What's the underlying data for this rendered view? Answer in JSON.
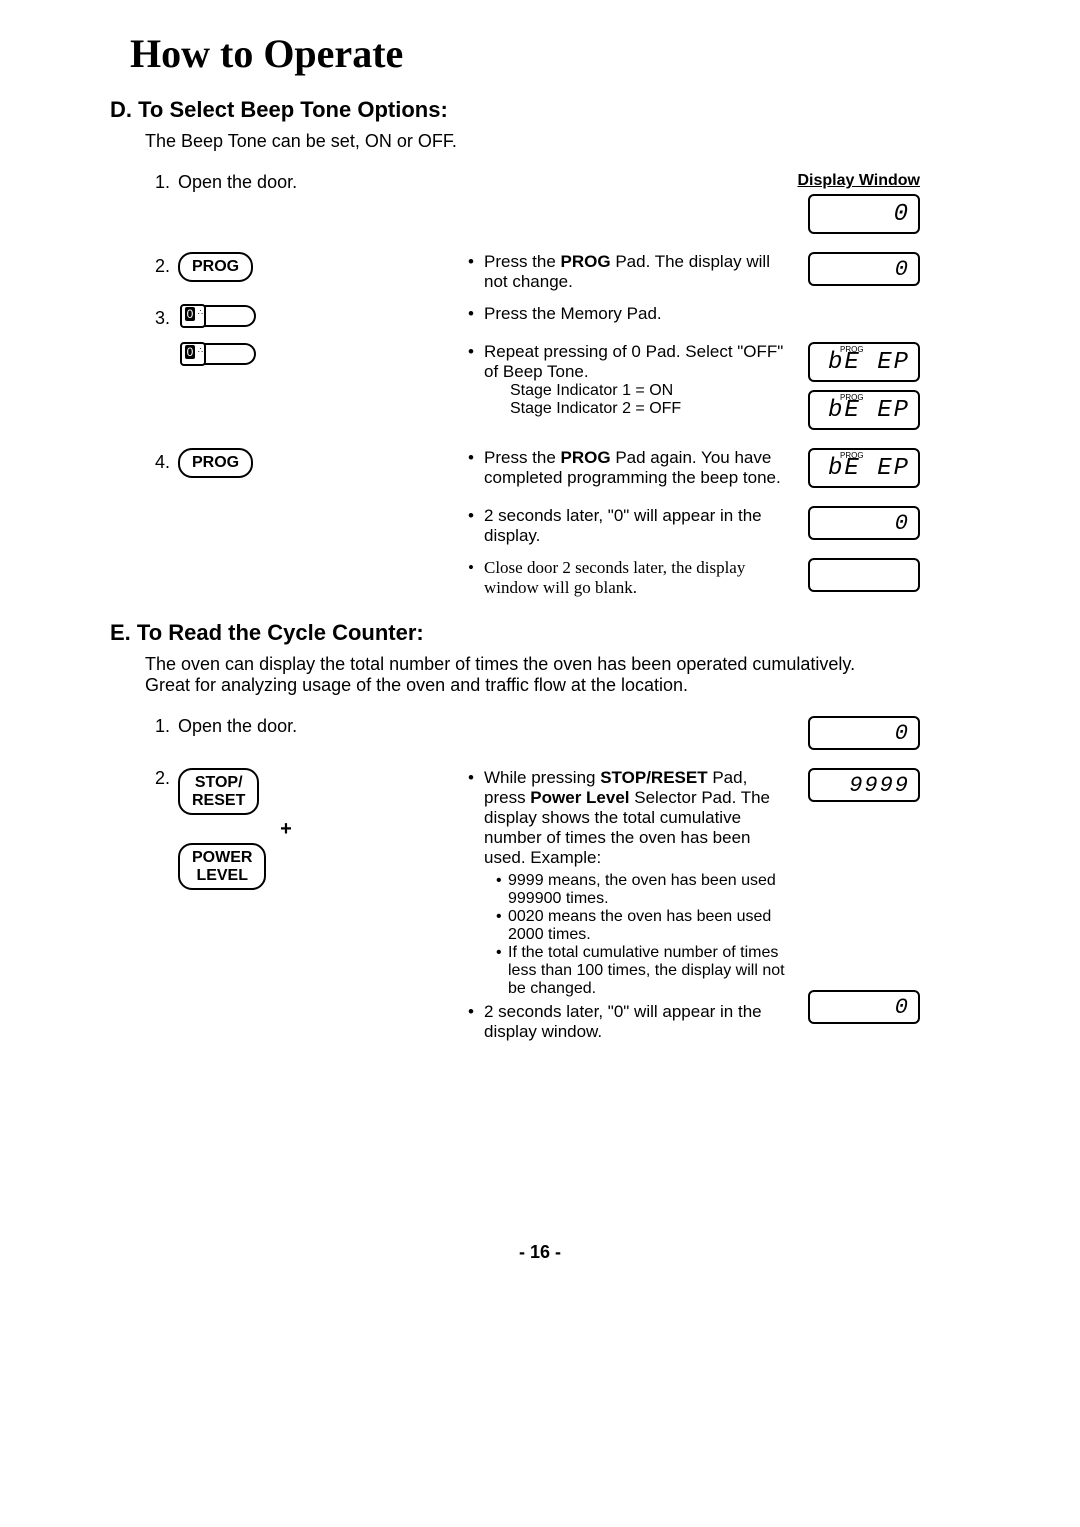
{
  "title": "How to Operate",
  "sectionD": {
    "heading": "D. To Select Beep Tone Options:",
    "intro": "The Beep Tone can be set, ON or OFF.",
    "display_label": "Display Window",
    "steps": {
      "s1_num": "1.",
      "s1_text": "Open the door.",
      "s2_num": "2.",
      "s2_pad": "PROG",
      "s2_desc": "Press the PROG Pad. The display will not change.",
      "s3_num": "3.",
      "s3_desc": "Press the Memory Pad.",
      "s3b_desc": "Repeat pressing of 0 Pad. Select \"OFF\" of Beep Tone.",
      "s3b_sub1": "Stage Indicator 1 = ON",
      "s3b_sub2": "Stage Indicator 2 = OFF",
      "s4_num": "4.",
      "s4_pad": "PROG",
      "s4_desc": "Press the PROG Pad again. You have completed programming the beep tone.",
      "s4b_desc": "2 seconds later, \"0\" will appear in the display.",
      "s4c_desc": "Close door 2 seconds later, the display window will go blank."
    },
    "displays": {
      "d1": "0",
      "d2": "0",
      "d3": "bE EP",
      "d4": "bE EP",
      "d5": "bE EP",
      "d6": "0",
      "d7": ""
    }
  },
  "sectionE": {
    "heading": "E. To Read the Cycle Counter:",
    "intro": "The oven can display the total number of times the oven has been operated cumulatively. Great for analyzing usage of the oven and traffic flow at the location.",
    "steps": {
      "s1_num": "1.",
      "s1_text": "Open the door.",
      "s2_num": "2.",
      "s2_pad1": "STOP/\nRESET",
      "s2_plus": "+",
      "s2_pad2": "POWER\nLEVEL",
      "s2_desc": "While pressing STOP/RESET Pad, press Power Level Selector Pad. The display shows the total cumulative number of times the oven has been used. Example:",
      "ex1": "9999 means, the oven has been used 999900 times.",
      "ex2": "0020 means the oven has been used 2000 times.",
      "ex3": "If the total cumulative number of times less than 100 times, the display will not be changed.",
      "s2b_desc": "2 seconds later, \"0\" will appear in the display window."
    },
    "displays": {
      "d1": "0",
      "d2": "9999",
      "d3": "0"
    }
  },
  "page_number": "- 16 -"
}
